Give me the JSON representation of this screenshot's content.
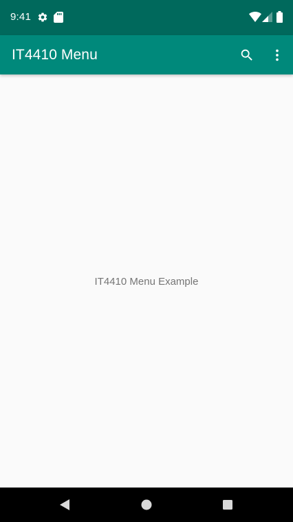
{
  "status_bar": {
    "time": "9:41",
    "left_icons": [
      "gear-icon",
      "sd-card-icon"
    ],
    "right_icons": [
      "wifi-icon",
      "cell-signal-icon",
      "battery-icon"
    ],
    "color": "#00695c"
  },
  "app_bar": {
    "title": "IT4410 Menu",
    "actions": [
      "search-icon",
      "more-vert-icon"
    ],
    "color": "#00897b"
  },
  "content": {
    "message": "IT4410 Menu Example"
  },
  "nav_bar": {
    "buttons": [
      "back-icon",
      "home-icon",
      "recents-icon"
    ]
  }
}
